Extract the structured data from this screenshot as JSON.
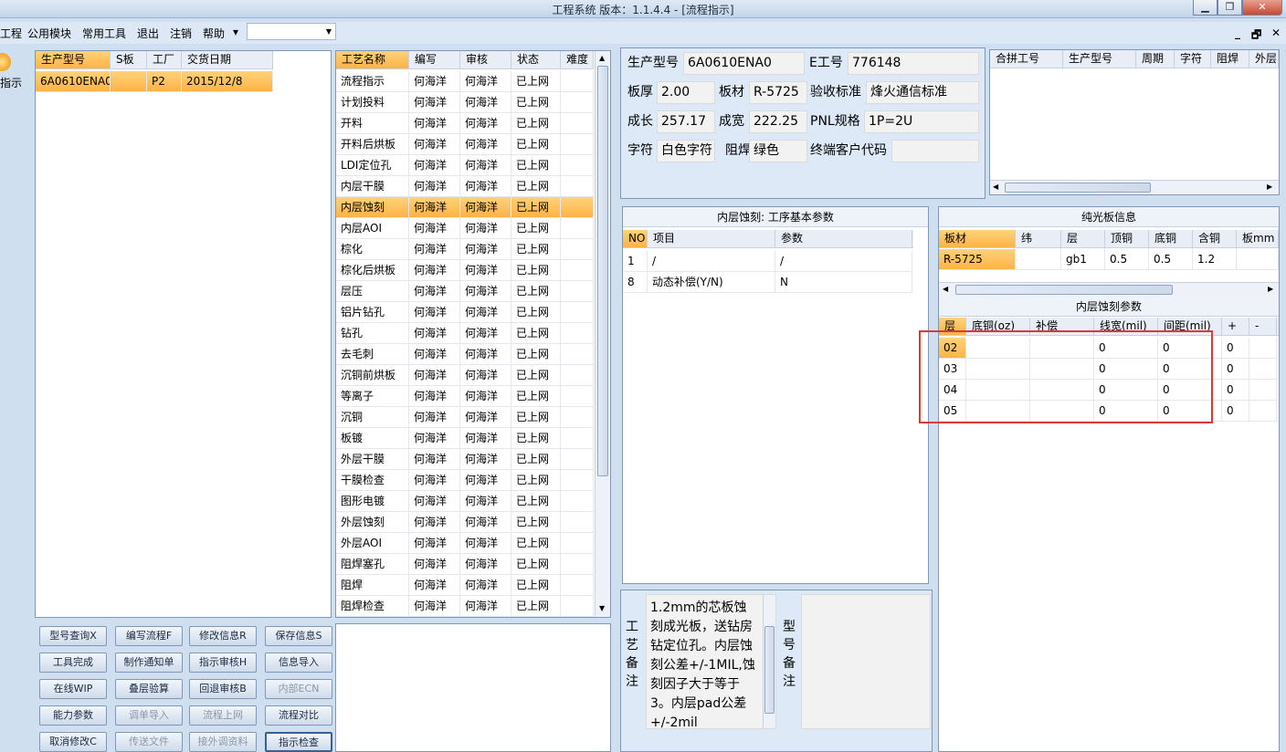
{
  "window": {
    "title": "工程系统    版本：1.1.4.4 - [流程指示]",
    "min": "▁",
    "restore": "❐",
    "close": "✕"
  },
  "menu": {
    "items": [
      "工程",
      "公用模块",
      "常用工具",
      "退出",
      "注销",
      "帮助"
    ],
    "help_arrow": "▾",
    "combo_value": "",
    "mdi_min": "_",
    "mdi_restore": "🗗",
    "mdi_close": "✕"
  },
  "left": {
    "button_label": "指示"
  },
  "orders": {
    "headers": [
      "生产型号",
      "S板",
      "工厂",
      "交货日期"
    ],
    "rows": [
      [
        "6A0610ENA0",
        "",
        "P2",
        "2015/12/8"
      ]
    ]
  },
  "process": {
    "headers": [
      "工艺名称",
      "编写",
      "审核",
      "状态",
      "难度"
    ],
    "selected_index": 6,
    "rows": [
      [
        "流程指示",
        "何海洋",
        "何海洋",
        "已上网"
      ],
      [
        "计划投料",
        "何海洋",
        "何海洋",
        "已上网"
      ],
      [
        "开料",
        "何海洋",
        "何海洋",
        "已上网"
      ],
      [
        "开料后烘板",
        "何海洋",
        "何海洋",
        "已上网"
      ],
      [
        "LDI定位孔",
        "何海洋",
        "何海洋",
        "已上网"
      ],
      [
        "内层干膜",
        "何海洋",
        "何海洋",
        "已上网"
      ],
      [
        "内层蚀刻",
        "何海洋",
        "何海洋",
        "已上网"
      ],
      [
        "内层AOI",
        "何海洋",
        "何海洋",
        "已上网"
      ],
      [
        "棕化",
        "何海洋",
        "何海洋",
        "已上网"
      ],
      [
        "棕化后烘板",
        "何海洋",
        "何海洋",
        "已上网"
      ],
      [
        "层压",
        "何海洋",
        "何海洋",
        "已上网"
      ],
      [
        "铝片钻孔",
        "何海洋",
        "何海洋",
        "已上网"
      ],
      [
        "钻孔",
        "何海洋",
        "何海洋",
        "已上网"
      ],
      [
        "去毛刺",
        "何海洋",
        "何海洋",
        "已上网"
      ],
      [
        "沉铜前烘板",
        "何海洋",
        "何海洋",
        "已上网"
      ],
      [
        "等离子",
        "何海洋",
        "何海洋",
        "已上网"
      ],
      [
        "沉铜",
        "何海洋",
        "何海洋",
        "已上网"
      ],
      [
        "板镀",
        "何海洋",
        "何海洋",
        "已上网"
      ],
      [
        "外层干膜",
        "何海洋",
        "何海洋",
        "已上网"
      ],
      [
        "干膜检查",
        "何海洋",
        "何海洋",
        "已上网"
      ],
      [
        "图形电镀",
        "何海洋",
        "何海洋",
        "已上网"
      ],
      [
        "外层蚀刻",
        "何海洋",
        "何海洋",
        "已上网"
      ],
      [
        "外层AOI",
        "何海洋",
        "何海洋",
        "已上网"
      ],
      [
        "阻焊塞孔",
        "何海洋",
        "何海洋",
        "已上网"
      ],
      [
        "阻焊",
        "何海洋",
        "何海洋",
        "已上网"
      ],
      [
        "阻焊检查",
        "何海洋",
        "何海洋",
        "已上网"
      ]
    ]
  },
  "buttons": [
    [
      "型号查询X",
      "编写流程F",
      "修改信息R",
      "保存信息S"
    ],
    [
      "工具完成",
      "制作通知单",
      "指示审核H",
      "信息导入"
    ],
    [
      "在线WIP",
      "叠层验算",
      "回退审核B",
      "内部ECN"
    ],
    [
      "能力参数",
      "调单导入",
      "流程上网",
      "流程对比"
    ],
    [
      "取消修改C",
      "传送文件",
      "接外调资料",
      "指示检查"
    ]
  ],
  "info": {
    "model_label": "生产型号",
    "model": "6A0610ENA0",
    "eno_label": "E工号",
    "eno": "776148",
    "thick_label": "板厚",
    "thick": "2.00",
    "mat_label": "板材",
    "mat": "R-5725",
    "std_label": "验收标准",
    "std": "烽火通信标准",
    "len_label": "成长",
    "len": "257.17",
    "wid_label": "成宽",
    "wid": "222.25",
    "pnl_label": "PNL规格",
    "pnl": "1P=2U",
    "char_label": "字符",
    "char": "白色字符",
    "mask_label": "阻焊",
    "mask": "绿色",
    "cust_label": "终端客户代码",
    "cust": ""
  },
  "combine": {
    "headers": [
      "合拼工号",
      "生产型号",
      "周期",
      "字符",
      "阻焊",
      "外层"
    ]
  },
  "params": {
    "title": "内层蚀刻: 工序基本参数",
    "headers": [
      "NO",
      "项目",
      "参数"
    ],
    "rows": [
      [
        "1",
        "/",
        "/"
      ],
      [
        "8",
        "动态补偿(Y/N)",
        "N"
      ]
    ]
  },
  "notes": {
    "label": "工艺备注",
    "text": "1.2mm的芯板蚀刻成光板，送钻房钻定位孔。内层蚀刻公差+/-1MIL,蚀刻因子大于等于3。内层pad公差+/-2mil",
    "model_label": "型号备注"
  },
  "board": {
    "title": "纯光板信息",
    "headers": [
      "板材",
      "纬",
      "层",
      "顶铜",
      "底铜",
      "含铜",
      "板mm"
    ],
    "rows": [
      [
        "R-5725",
        "",
        "gb1",
        "0.5",
        "0.5",
        "1.2",
        ""
      ]
    ]
  },
  "etch": {
    "title": "内层蚀刻参数",
    "headers": [
      "层",
      "底铜(oz)",
      "补偿",
      "线宽(mil)",
      "间距(mil)",
      "+",
      "-"
    ],
    "rows": [
      [
        "02",
        "",
        "",
        "0",
        "0",
        "0",
        ""
      ],
      [
        "03",
        "",
        "",
        "0",
        "0",
        "0",
        ""
      ],
      [
        "04",
        "",
        "",
        "0",
        "0",
        "0",
        ""
      ],
      [
        "05",
        "",
        "",
        "0",
        "0",
        "0",
        ""
      ]
    ]
  }
}
